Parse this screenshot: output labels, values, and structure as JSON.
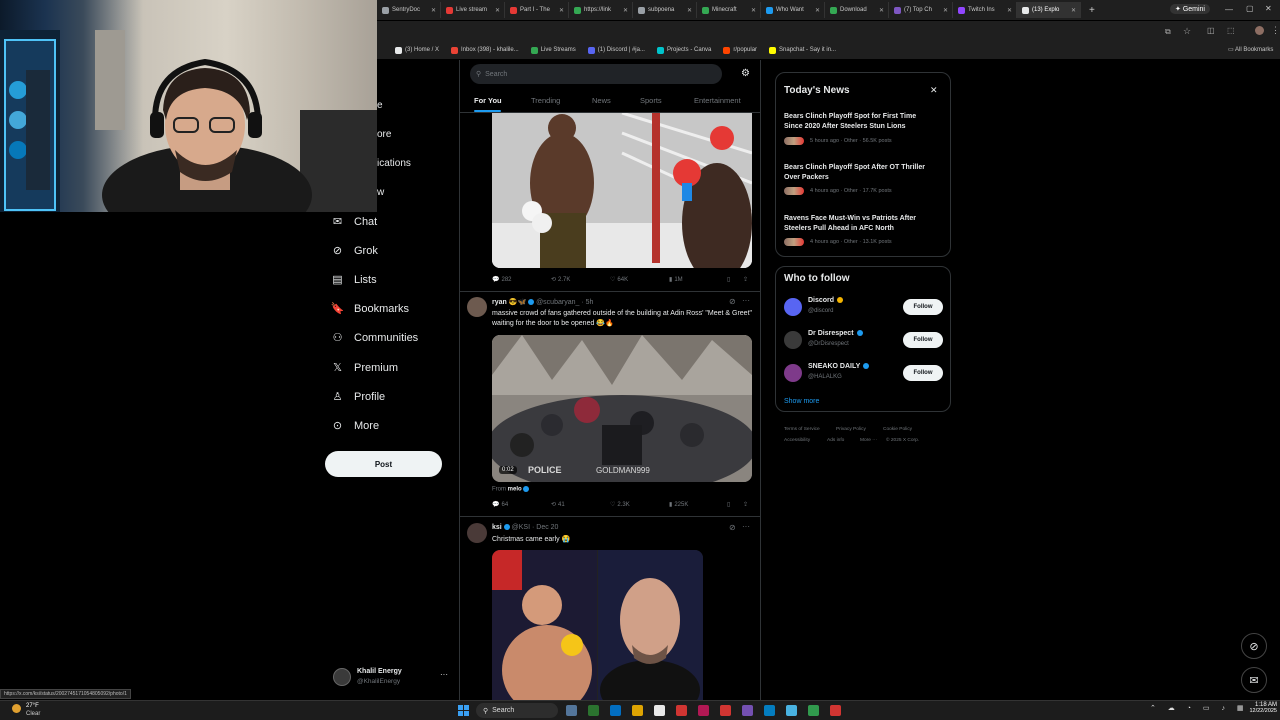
{
  "browser": {
    "tabs": [
      {
        "label": "SentryDoc",
        "color": "#9aa0a6"
      },
      {
        "label": "Live stream",
        "color": "#e53935"
      },
      {
        "label": "Part I - The",
        "color": "#e53935"
      },
      {
        "label": "https://link",
        "color": "#34a853"
      },
      {
        "label": "subpoena",
        "color": "#9aa0a6"
      },
      {
        "label": "Minecraft",
        "color": "#34a853"
      },
      {
        "label": "Who Want",
        "color": "#1d9bf0"
      },
      {
        "label": "Download",
        "color": "#34a853"
      },
      {
        "label": "(7) Top Ch",
        "color": "#7e57c2"
      },
      {
        "label": "Twitch Ins",
        "color": "#9146ff"
      },
      {
        "label": "(13) Explo",
        "color": "#e7e9ea"
      }
    ],
    "gemini_label": "Gemini",
    "bookmarks": [
      {
        "label": "(3) Home / X",
        "color": "#e7e9ea"
      },
      {
        "label": "Inbox (398) - khalile...",
        "color": "#ea4335"
      },
      {
        "label": "Live Streams",
        "color": "#34a853"
      },
      {
        "label": "(1) Discord | #ja...",
        "color": "#5865f2"
      },
      {
        "label": "Projects - Canva",
        "color": "#00c4cc"
      },
      {
        "label": "r/popular",
        "color": "#ff4500"
      },
      {
        "label": "Snapchat - Say it in...",
        "color": "#fffc00"
      }
    ],
    "all_bookmarks_label": "All Bookmarks"
  },
  "sidebar": {
    "partial_items": [
      {
        "label": "e",
        "icon": "home-icon"
      },
      {
        "label": "ore",
        "icon": "explore-icon"
      },
      {
        "label": "ications",
        "icon": "bell-icon"
      },
      {
        "label": "w",
        "icon": "follow-icon"
      }
    ],
    "items": [
      {
        "label": "Chat",
        "icon": "chat-icon"
      },
      {
        "label": "Grok",
        "icon": "grok-icon"
      },
      {
        "label": "Lists",
        "icon": "lists-icon"
      },
      {
        "label": "Bookmarks",
        "icon": "bookmark-icon"
      },
      {
        "label": "Communities",
        "icon": "communities-icon"
      },
      {
        "label": "Premium",
        "icon": "x-logo-icon"
      },
      {
        "label": "Profile",
        "icon": "profile-icon"
      },
      {
        "label": "More",
        "icon": "more-icon"
      }
    ],
    "post_label": "Post",
    "account": {
      "name": "Khalil Energy",
      "handle": "@KhalilEnergy"
    }
  },
  "search": {
    "placeholder": "Search"
  },
  "feed_tabs": [
    "For You",
    "Trending",
    "News",
    "Sports",
    "Entertainment"
  ],
  "posts": [
    {
      "actions": {
        "replies": "282",
        "reposts": "2.7K",
        "likes": "64K",
        "views": "1M"
      }
    },
    {
      "author": "ryan",
      "handle": "@scubaryan_",
      "time": "5h",
      "text": "massive crowd of fans gathered outside of the building at Adin Ross' \"Meet & Greet\" waiting for the door to be opened 😂🔥",
      "video_duration": "0:02",
      "overlay_left": "POLICE",
      "overlay_right": "GOLDMAN999",
      "from_label": "From",
      "from_name": "melo",
      "actions": {
        "replies": "64",
        "reposts": "41",
        "likes": "2.3K",
        "views": "225K"
      }
    },
    {
      "author": "ksi",
      "handle": "@KSI",
      "time": "Dec 20",
      "text": "Christmas came early 😭"
    }
  ],
  "todays_news": {
    "title": "Today's News",
    "items": [
      {
        "headline": "Bears Clinch Playoff Spot for First Time Since 2020 After Steelers Stun Lions",
        "meta": "5 hours ago · Other · 56.5K posts"
      },
      {
        "headline": "Bears Clinch Playoff Spot After OT Thriller Over Packers",
        "meta": "4 hours ago · Other · 17.7K posts"
      },
      {
        "headline": "Ravens Face Must-Win vs Patriots After Steelers Pull Ahead in AFC North",
        "meta": "4 hours ago · Other · 13.1K posts"
      }
    ]
  },
  "who_to_follow": {
    "title": "Who to follow",
    "accounts": [
      {
        "name": "Discord",
        "handle": "@discord",
        "button": "Follow"
      },
      {
        "name": "Dr Disrespect",
        "handle": "@DrDisrespect",
        "button": "Follow"
      },
      {
        "name": "SNEAKO DAILY",
        "handle": "@HALALKG",
        "button": "Follow"
      }
    ],
    "show_more": "Show more"
  },
  "footer_links": [
    "Terms of Service",
    "Privacy Policy",
    "Cookie Policy",
    "Accessibility",
    "Ads info",
    "More ···",
    "© 2025 X Corp."
  ],
  "status_url": "https://x.com/ksi/status/2002745171054805092/photo/1",
  "taskbar": {
    "weather_temp": "27°F",
    "weather_cond": "Clear",
    "search_label": "Search",
    "time": "1:18 AM",
    "date": "12/22/2025"
  }
}
